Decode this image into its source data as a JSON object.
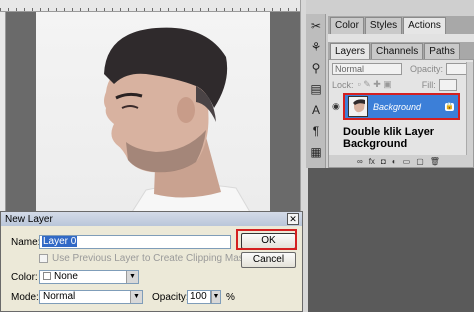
{
  "panels": {
    "top_tabs": [
      "Color",
      "Styles",
      "Actions"
    ],
    "bottom_tabs": [
      "Layers",
      "Channels",
      "Paths"
    ],
    "blend_mode": "Normal",
    "opacity_label": "Opacity:",
    "lock_label": "Lock:",
    "fill_label": "Fill:",
    "layer_name": "Background",
    "annotation": "Double klik Layer Background"
  },
  "dialog": {
    "title": "New Layer",
    "name_label": "Name:",
    "name_value": "Layer 0",
    "clip_label": "Use Previous Layer to Create Clipping Mask",
    "color_label": "Color:",
    "color_value": "None",
    "mode_label": "Mode:",
    "mode_value": "Normal",
    "opacity_label": "Opacity:",
    "opacity_value": "100",
    "opacity_unit": "%",
    "ok_label": "OK",
    "cancel_label": "Cancel"
  },
  "colors": {
    "highlight_outline": "#d42020",
    "selected_layer": "#3c7fd8"
  }
}
